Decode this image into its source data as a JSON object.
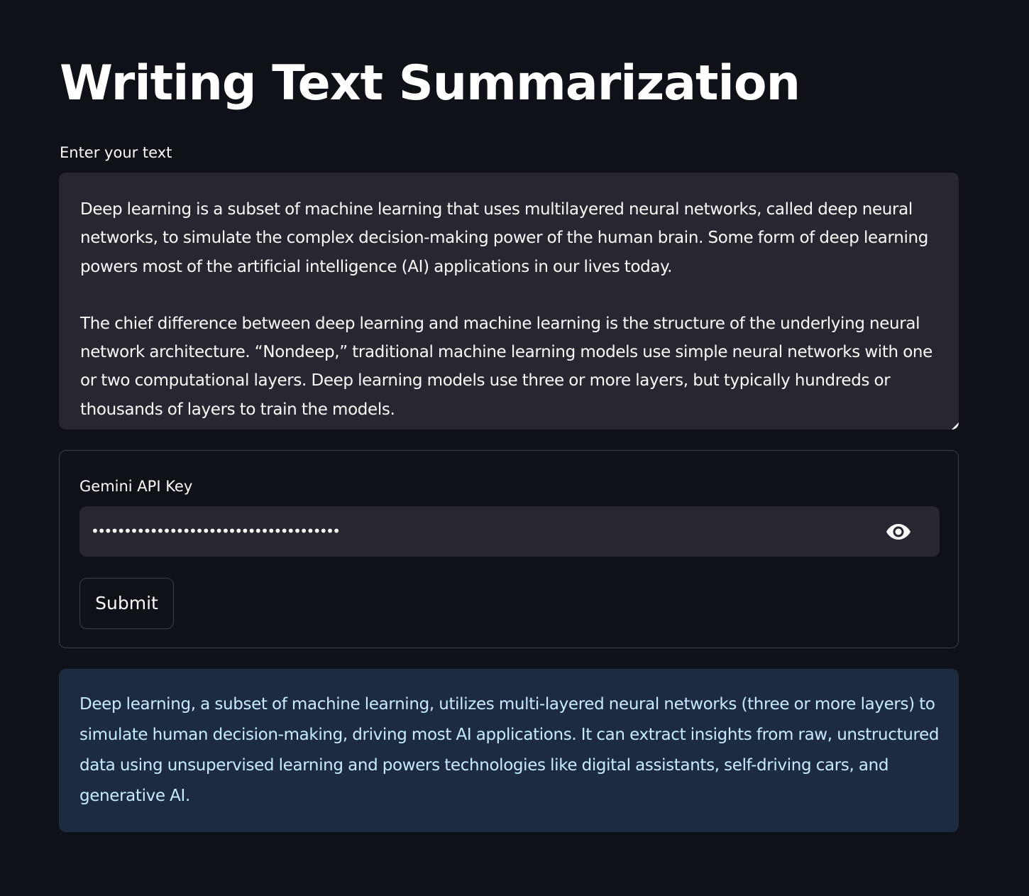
{
  "page": {
    "title": "Writing Text Summarization"
  },
  "text_input": {
    "label": "Enter your text",
    "paragraphs": [
      "Deep learning is a subset of machine learning that uses multilayered neural networks, called deep neural networks, to simulate the complex decision-making power of the human brain. Some form of deep learning powers most of the artificial intelligence (AI) applications in our lives today.",
      "The chief difference between deep learning and machine learning is the structure of the underlying neural network architecture. “Nondeep,” traditional machine learning models use simple neural networks with one or two computational layers. Deep learning models use three or more layers, but typically hundreds or thousands of layers to train the models."
    ]
  },
  "form": {
    "api_key_label": "Gemini API Key",
    "api_key_value": "••••••••••••••••••••••••••••••••••••••",
    "submit_label": "Submit",
    "toggle_icon": "eye-icon"
  },
  "result": {
    "text": "Deep learning, a subset of machine learning, utilizes multi-layered neural networks (three or more layers) to simulate human decision-making, driving most AI applications. It can extract insights from raw, unstructured data using unsupervised learning and powers technologies like digital assistants, self-driving cars, and generative AI."
  },
  "colors": {
    "background": "#0e1117",
    "input_background": "#262730",
    "border": "#3b3d47",
    "result_background": "#1c2b40",
    "result_text": "#c7ebff"
  }
}
